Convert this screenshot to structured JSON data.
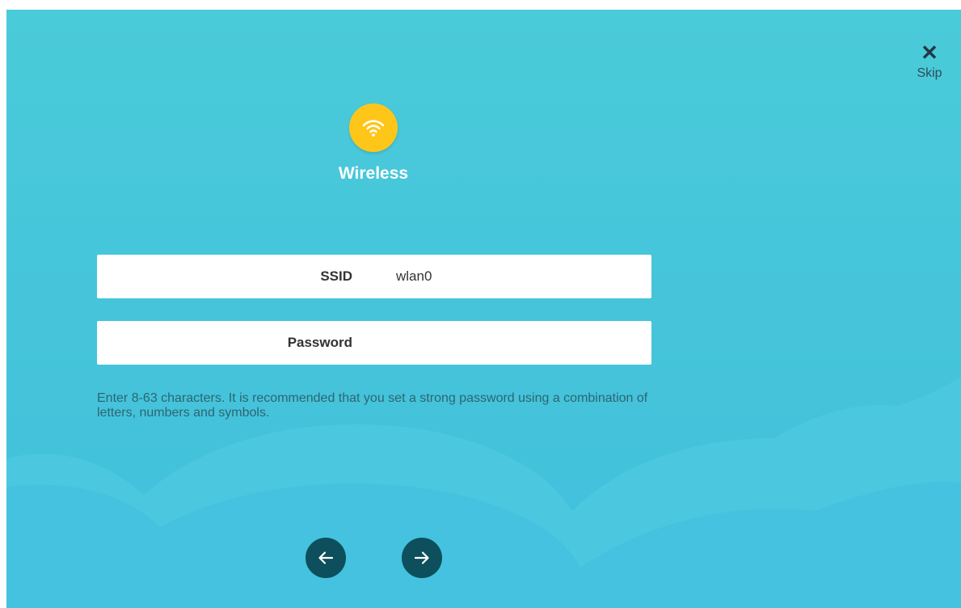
{
  "header": {
    "skip_icon": "close-icon",
    "skip_label": "Skip"
  },
  "section": {
    "icon": "wifi-icon",
    "icon_color": "#ffc61a",
    "title": "Wireless"
  },
  "form": {
    "ssid": {
      "label": "SSID",
      "value": "wlan0"
    },
    "password": {
      "label": "Password",
      "value": ""
    },
    "hint": "Enter 8-63 characters. It is recommended that you set a strong password using a combination of letters, numbers and symbols."
  },
  "navigation": {
    "prev_icon": "arrow-left-icon",
    "next_icon": "arrow-right-icon",
    "button_color": "#0d4f5c"
  },
  "colors": {
    "background": "#45c4da",
    "accent": "#ffc61a"
  }
}
